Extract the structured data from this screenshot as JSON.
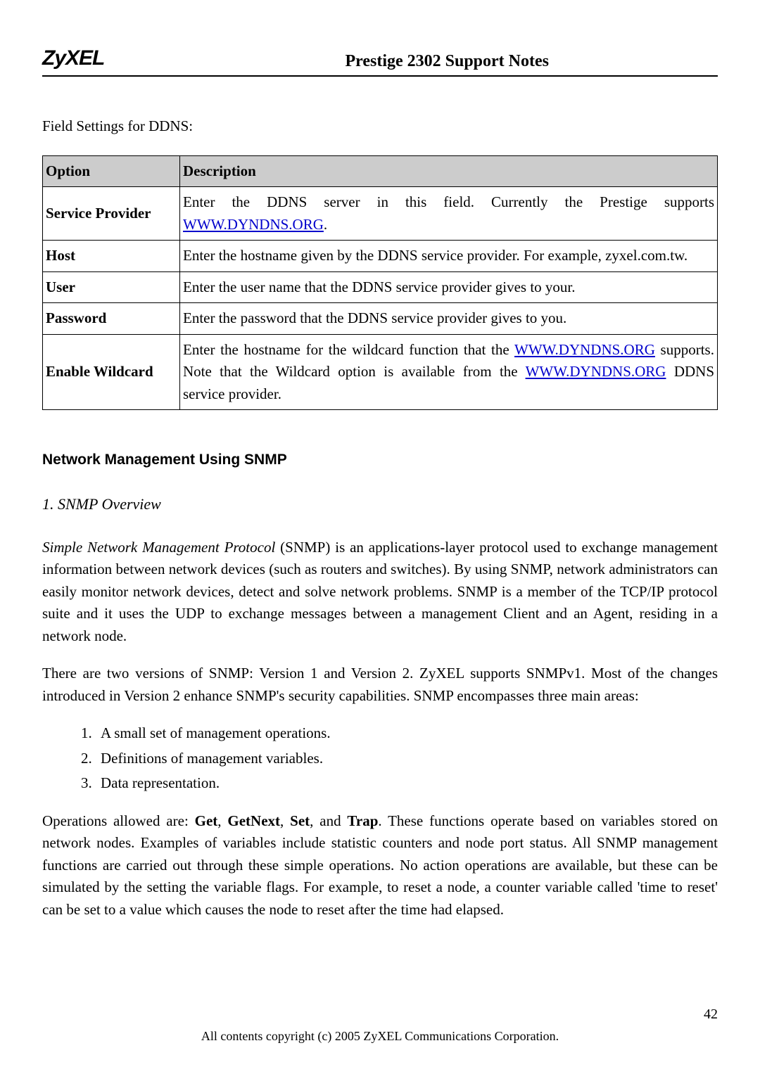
{
  "header": {
    "logo": "ZyXEL",
    "title": "Prestige 2302 Support Notes"
  },
  "intro": "Field Settings for DDNS:",
  "table": {
    "headers": {
      "option": "Option",
      "description": "Description"
    },
    "rows": {
      "service_provider": {
        "option": "Service Provider",
        "desc_pre": "Enter the DDNS server in this field. Currently the Prestige supports ",
        "link": "WWW.DYNDNS.ORG",
        "desc_post": "."
      },
      "host": {
        "option": "Host",
        "desc": "Enter the hostname given by the DDNS service provider. For example, zyxel.com.tw."
      },
      "user": {
        "option": "User",
        "desc": "Enter the user name that the DDNS service provider gives to your."
      },
      "password": {
        "option": "Password",
        "desc": "Enter the password that the DDNS service provider gives to you."
      },
      "wildcard": {
        "option": "Enable Wildcard",
        "d1": "Enter the hostname for the wildcard function that the ",
        "link1": "WWW.DYNDNS.ORG",
        "d2": " supports. Note that the Wildcard option is available from the ",
        "link2": "WWW.DYNDNS.ORG",
        "d3": " DDNS service provider."
      }
    }
  },
  "section_heading": "Network Management Using SNMP",
  "sub_heading": "1. SNMP Overview",
  "para1_em": "Simple Network Management Protocol",
  "para1_rest": " (SNMP) is an applications-layer protocol used to exchange management information between network devices (such as routers and switches). By using SNMP, network administrators can easily monitor network devices, detect and solve network problems. SNMP is a member of the TCP/IP protocol suite and it uses the UDP to exchange messages between a management Client and an Agent, residing in a network node.",
  "para2": "There are two versions of SNMP: Version 1 and Version 2. ZyXEL supports SNMPv1. Most of the changes introduced in Version 2 enhance SNMP's security capabilities. SNMP encompasses three main areas:",
  "list": {
    "i1": "A small set of management operations.",
    "i2": "Definitions of management variables.",
    "i3": "Data representation."
  },
  "para3_pre": "Operations allowed are: ",
  "ops": {
    "o1": "Get",
    "c1": ", ",
    "o2": "GetNext",
    "c2": ", ",
    "o3": "Set",
    "c3": ", ",
    "and": "and ",
    "o4": "Trap"
  },
  "para3_post": ". These functions operate based on variables stored on network nodes. Examples of variables include statistic counters and node port status. All SNMP management functions are carried out through these simple operations. No action operations are available, but these can be simulated by the setting the variable flags. For example, to reset a node, a counter variable called 'time to reset' can be set to a value which causes the node to reset after the time had elapsed.",
  "page_number": "42",
  "copyright": "All contents copyright (c) 2005 ZyXEL Communications Corporation."
}
